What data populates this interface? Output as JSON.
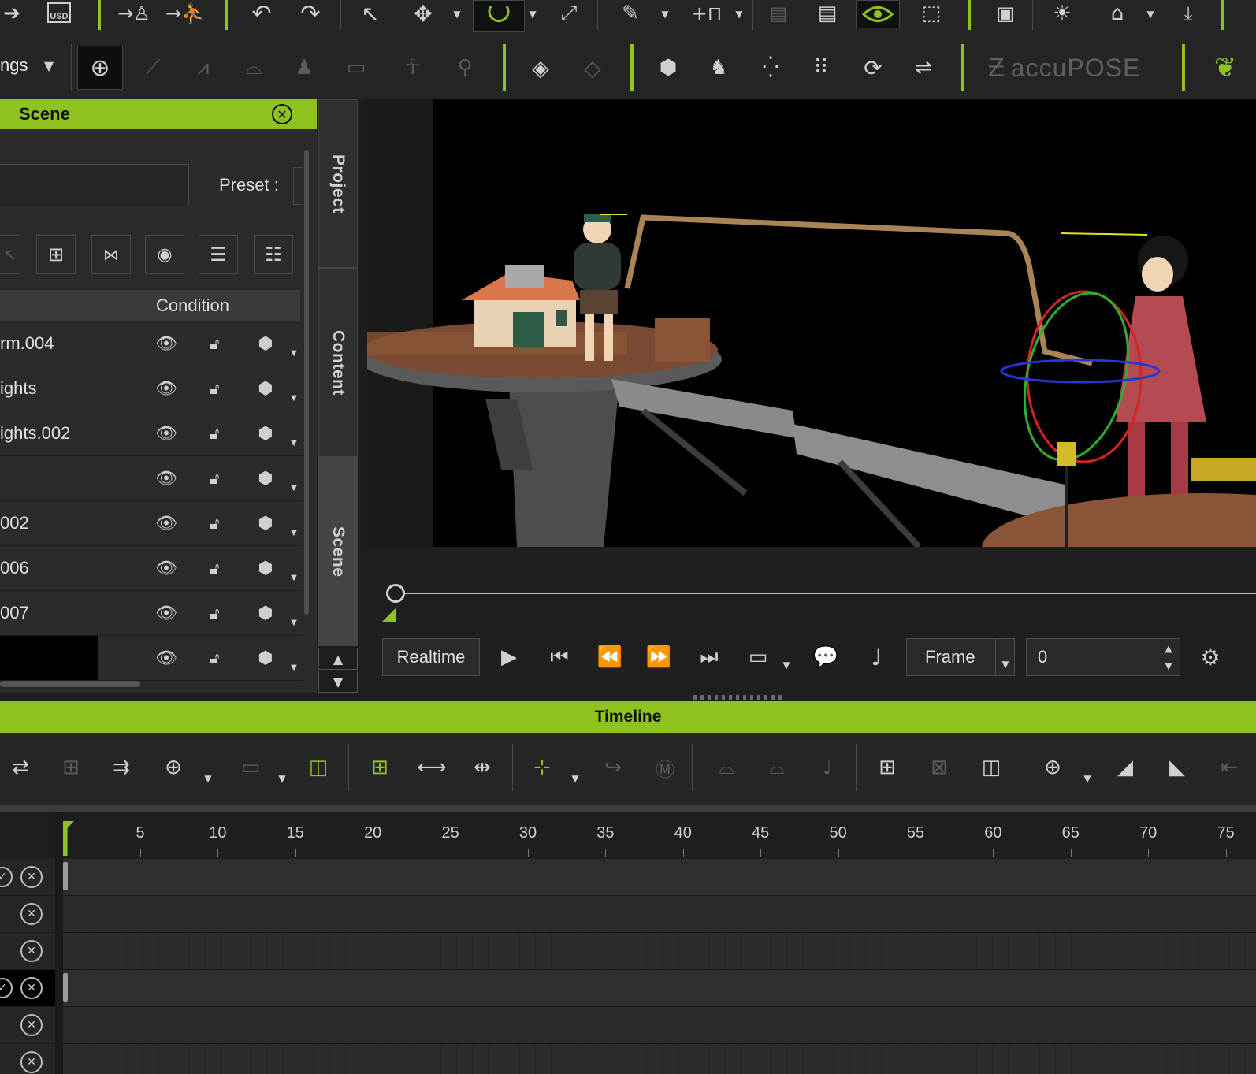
{
  "toolbar": {
    "settings_combo_label": "ngs",
    "accupose_label": "accuPOSE"
  },
  "scene_panel": {
    "title": "Scene",
    "preset_label": "Preset :",
    "columns": {
      "condition": "Condition"
    },
    "rows": [
      {
        "name": "rm.004"
      },
      {
        "name": "ights"
      },
      {
        "name": "ights.002"
      },
      {
        "name": ""
      },
      {
        "name": "002"
      },
      {
        "name": "006"
      },
      {
        "name": "007"
      },
      {
        "name": ""
      }
    ]
  },
  "side_tabs": {
    "project": "Project",
    "content": "Content",
    "scene": "Scene"
  },
  "playback": {
    "realtime_label": "Realtime",
    "frame_mode_label": "Frame",
    "frame_value": "0"
  },
  "timeline": {
    "title": "Timeline",
    "ruler_labels": [
      "5",
      "10",
      "15",
      "20",
      "25",
      "30",
      "35",
      "40",
      "45",
      "50",
      "55",
      "60",
      "65",
      "70",
      "75"
    ]
  },
  "colors": {
    "accent": "#8dc21f",
    "panel": "#2b2b2b",
    "background": "#1e1e1e"
  }
}
